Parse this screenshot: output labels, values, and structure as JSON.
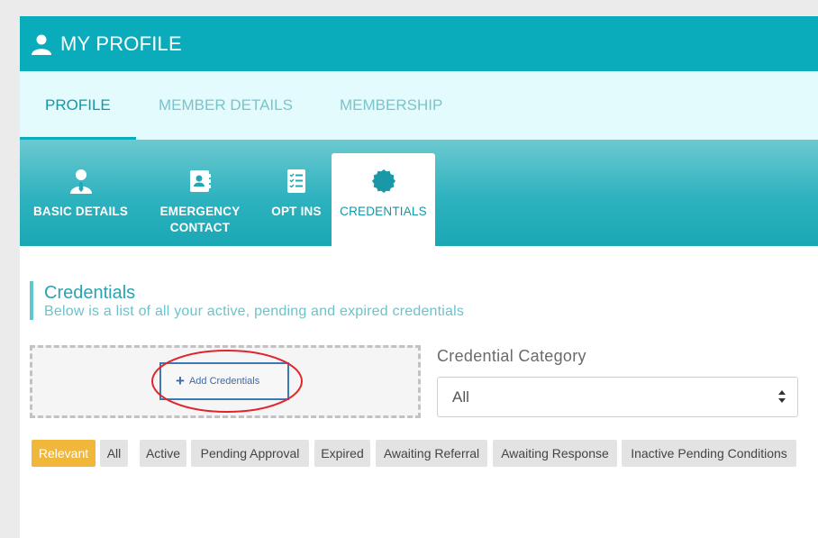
{
  "header": {
    "title": "MY PROFILE",
    "icon": "user-icon"
  },
  "main_tabs": [
    {
      "label": "PROFILE",
      "active": true
    },
    {
      "label": "MEMBER DETAILS",
      "active": false
    },
    {
      "label": "MEMBERSHIP",
      "active": false
    }
  ],
  "sub_tabs": [
    {
      "label": "BASIC DETAILS",
      "icon": "person-tie-icon",
      "active": false
    },
    {
      "label": "EMERGENCY\nCONTACT",
      "icon": "contact-book-icon",
      "active": false
    },
    {
      "label": "OPT INS",
      "icon": "checklist-icon",
      "active": false
    },
    {
      "label": "CREDENTIALS",
      "icon": "badge-seal-icon",
      "active": true
    }
  ],
  "section": {
    "title": "Credentials",
    "subtitle": "Below is a list of all your active, pending and expired credentials"
  },
  "add_credentials": {
    "label": "Add Credentials",
    "icon": "plus-icon"
  },
  "category": {
    "label": "Credential Category",
    "selected": "All"
  },
  "filters": [
    {
      "label": "Relevant",
      "active": true
    },
    {
      "label": "All",
      "active": false
    },
    {
      "label": "Active",
      "active": false
    },
    {
      "label": "Pending Approval",
      "active": false
    },
    {
      "label": "Expired",
      "active": false
    },
    {
      "label": "Awaiting Referral",
      "active": false
    },
    {
      "label": "Awaiting Response",
      "active": false
    },
    {
      "label": "Inactive Pending Conditions",
      "active": false
    }
  ],
  "colors": {
    "teal": "#0aabbb",
    "annotation": "#e0262b",
    "relevant_chip": "#f0b73a"
  }
}
